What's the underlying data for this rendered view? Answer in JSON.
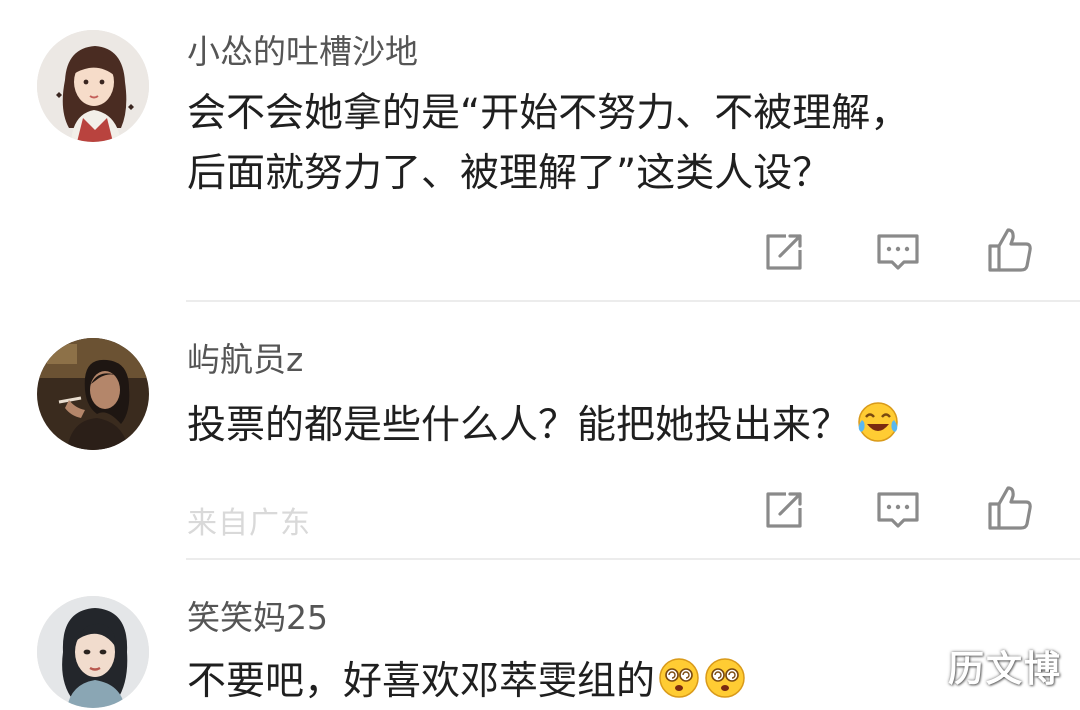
{
  "comments": [
    {
      "username": "小怂的吐槽沙地",
      "lines": [
        "会不会她拿的是“开始不努力、不被理解，",
        "后面就努力了、被理解了”这类人设？"
      ]
    },
    {
      "username": "屿航员z",
      "text": "投票的都是些什么人？能把她投出来？",
      "emoji_name": "laugh-cry-emoji",
      "meta_faded": "来自广东"
    },
    {
      "username": "笑笑妈25",
      "text": "不要吧，好喜欢邓萃雯组的",
      "emoji_name": "dizzy-face-emoji"
    }
  ],
  "watermark": "历文博",
  "colors": {
    "username": "#555555",
    "text": "#1f1f1f",
    "icon": "#8a8a8a",
    "divider": "#ececec"
  }
}
